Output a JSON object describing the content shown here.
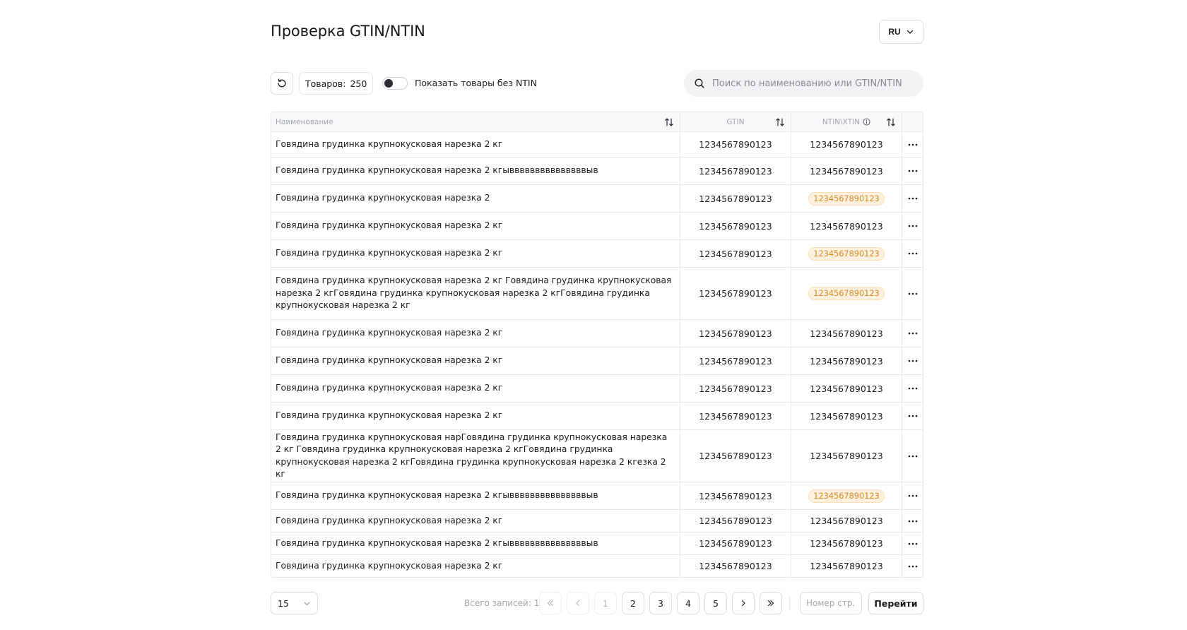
{
  "header": {
    "title": "Проверка GTIN/NTIN",
    "lang": "RU"
  },
  "toolbar": {
    "count_label": "Товаров:",
    "count_value": "250",
    "toggle_label": "Показать товары без NTIN",
    "search_placeholder": "Поиск по наименованию или GTIN/NTIN"
  },
  "table": {
    "columns": {
      "name": "Наименование",
      "gtin": "GTIN",
      "ntin": "NTIN\\XTIN"
    },
    "rows": [
      {
        "name": "Говядина грудинка крупнокусковая нарезка 2 кг",
        "gtin": "1234567890123",
        "ntin": "1234567890123",
        "warn": false,
        "h": 36
      },
      {
        "name": "Говядина грудинка крупнокусковая нарезка 2 кгывввввввввввввввыв",
        "gtin": "1234567890123",
        "ntin": "1234567890123",
        "warn": false,
        "h": 39
      },
      {
        "name": "Говядина грудинка крупнокусковая нарезка 2",
        "gtin": "1234567890123",
        "ntin": "1234567890123",
        "warn": true,
        "h": 39
      },
      {
        "name": "Говядина грудинка крупнокусковая нарезка 2 кг",
        "gtin": "1234567890123",
        "ntin": "1234567890123",
        "warn": false,
        "h": 39
      },
      {
        "name": "Говядина грудинка крупнокусковая нарезка 2 кг",
        "gtin": "1234567890123",
        "ntin": "1234567890123",
        "warn": true,
        "h": 39
      },
      {
        "name": "Говядина грудинка крупнокусковая нарезка 2 кг Говядина грудинка крупнокусковая нарезка 2 кгГовядина грудинка крупнокусковая нарезка 2 кгГовядина грудинка крупнокусковая нарезка 2 кг",
        "gtin": "1234567890123",
        "ntin": "1234567890123",
        "warn": true,
        "h": 74
      },
      {
        "name": "Говядина грудинка крупнокусковая нарезка 2 кг",
        "gtin": "1234567890123",
        "ntin": "1234567890123",
        "warn": false,
        "h": 39
      },
      {
        "name": "Говядина грудинка крупнокусковая нарезка 2 кг",
        "gtin": "1234567890123",
        "ntin": "1234567890123",
        "warn": false,
        "h": 39
      },
      {
        "name": "Говядина грудинка крупнокусковая нарезка 2 кг",
        "gtin": "1234567890123",
        "ntin": "1234567890123",
        "warn": false,
        "h": 39
      },
      {
        "name": "Говядина грудинка крупнокусковая нарезка 2 кг",
        "gtin": "1234567890123",
        "ntin": "1234567890123",
        "warn": false,
        "h": 39
      },
      {
        "name": "Говядина грудинка крупнокусковая нарГовядина грудинка крупнокусковая нарезка 2 кг Говядина грудинка крупнокусковая нарезка 2 кгГовядина грудинка крупнокусковая нарезка 2 кгГовядина грудинка крупнокусковая нарезка 2 кгезка 2 кг",
        "gtin": "1234567890123",
        "ntin": "1234567890123",
        "warn": false,
        "h": 74
      },
      {
        "name": "Говядина грудинка крупнокусковая нарезка 2 кгывввввввввввввввыв",
        "gtin": "1234567890123",
        "ntin": "1234567890123",
        "warn": true,
        "h": 39
      },
      {
        "name": "Говядина грудинка крупнокусковая нарезка 2 кг",
        "gtin": "1234567890123",
        "ntin": "1234567890123",
        "warn": false,
        "h": 32
      },
      {
        "name": "Говядина грудинка крупнокусковая нарезка 2 кгывввввввввввввввыв",
        "gtin": "1234567890123",
        "ntin": "1234567890123",
        "warn": false,
        "h": 32
      },
      {
        "name": "Говядина грудинка крупнокусковая нарезка 2 кг",
        "gtin": "1234567890123",
        "ntin": "1234567890123",
        "warn": false,
        "h": 31
      }
    ]
  },
  "pagination": {
    "per_page": "15",
    "total_label": "Всего записей: 1",
    "pages": [
      "1",
      "2",
      "3",
      "4",
      "5"
    ],
    "page_input_placeholder": "Номер стр.",
    "go_label": "Перейти"
  },
  "colors": {
    "warn_bg": "#fdf1dd",
    "warn_text": "#d58a26",
    "border": "#e7e8eb"
  },
  "icons": [
    "refresh-icon",
    "search-icon",
    "chevron-down-icon",
    "sort-icon",
    "info-icon",
    "more-horizontal-icon",
    "chevrons-left-icon",
    "chevron-left-icon",
    "chevron-right-icon",
    "chevrons-right-icon"
  ]
}
